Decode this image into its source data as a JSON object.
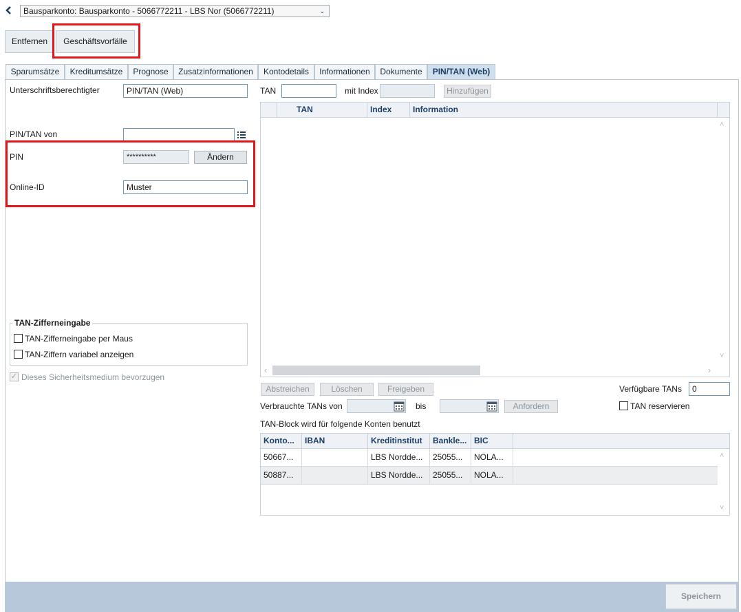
{
  "header": {
    "back_icon": "chevron-left-icon",
    "account_select": "Bausparkonto: Bausparkonto - 5066772211 - LBS Nor (5066772211)"
  },
  "toolbar": {
    "remove_label": "Entfernen",
    "transactions_label": "Geschäftsvorfälle"
  },
  "tabs": [
    {
      "label": "Sparumsätze"
    },
    {
      "label": "Kreditumsätze"
    },
    {
      "label": "Prognose"
    },
    {
      "label": "Zusatzinformationen"
    },
    {
      "label": "Kontodetails"
    },
    {
      "label": "Informationen"
    },
    {
      "label": "Dokumente"
    },
    {
      "label": "PIN/TAN (Web)",
      "active": true
    }
  ],
  "left": {
    "signatory_label": "Unterschriftsberechtigter",
    "signatory_value": "PIN/TAN (Web)",
    "pintan_from_label": "PIN/TAN von",
    "pintan_from_value": "",
    "pin_label": "PIN",
    "pin_value": "**********",
    "change_label": "Ändern",
    "online_id_label": "Online-ID",
    "online_id_value": "Muster",
    "group_title": "TAN-Zifferneingabe",
    "cb_mouse": "TAN-Zifferneingabe per Maus",
    "cb_variable": "TAN-Ziffern variabel anzeigen",
    "cb_prefer": "Dieses Sicherheitsmedium bevorzugen"
  },
  "right": {
    "tan_label": "TAN",
    "index_label": "mit Index",
    "add_label": "Hinzufügen",
    "tan_table": {
      "headers": [
        "",
        "TAN",
        "Index",
        "Information"
      ]
    },
    "buttons": {
      "strike": "Abstreichen",
      "delete": "Löschen",
      "release": "Freigeben"
    },
    "available_label": "Verfügbare TANs",
    "available_value": "0",
    "used_from_label": "Verbrauchte TANs von",
    "until_label": "bis",
    "request_label": "Anfordern",
    "reserve_label": "TAN reservieren",
    "block_label": "TAN-Block wird für folgende Konten benutzt",
    "accounts_table": {
      "headers": [
        "Konto...",
        "IBAN",
        "Kreditinstitut",
        "Bankle...",
        "BIC"
      ],
      "rows": [
        [
          "50667...",
          "",
          "LBS Nordde...",
          "25055...",
          "NOLA..."
        ],
        [
          "50887...",
          "",
          "LBS Nordde...",
          "25055...",
          "NOLA..."
        ]
      ]
    }
  },
  "footer": {
    "save_label": "Speichern"
  },
  "colors": {
    "accent": "#1d3f66",
    "highlight": "#e1161b",
    "footer_bar": "#b7c8db"
  }
}
